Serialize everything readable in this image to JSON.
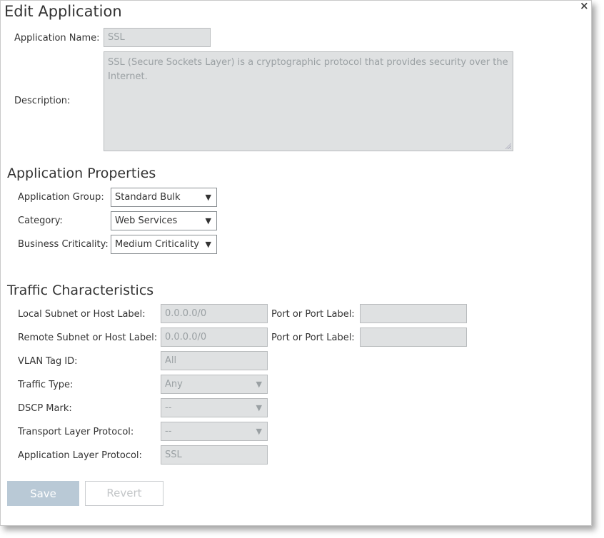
{
  "dialog": {
    "title": "Edit Application",
    "close_glyph": "×"
  },
  "general": {
    "app_name_label": "Application Name:",
    "app_name_value": "SSL",
    "description_label": "Description:",
    "description_value": "SSL (Secure Sockets Layer) is a cryptographic protocol that provides security over the Internet."
  },
  "properties": {
    "heading": "Application Properties",
    "group_label": "Application Group:",
    "group_value": "Standard Bulk",
    "category_label": "Category:",
    "category_value": "Web Services",
    "criticality_label": "Business Criticality:",
    "criticality_value": "Medium Criticality"
  },
  "traffic": {
    "heading": "Traffic Characteristics",
    "local_subnet_label": "Local Subnet or Host Label:",
    "local_subnet_value": "0.0.0.0/0",
    "local_port_label": "Port or Port Label:",
    "local_port_value": "",
    "remote_subnet_label": "Remote Subnet or Host Label:",
    "remote_subnet_value": "0.0.0.0/0",
    "remote_port_label": "Port or Port Label:",
    "remote_port_value": "",
    "vlan_label": "VLAN Tag ID:",
    "vlan_value": "All",
    "traffic_type_label": "Traffic Type:",
    "traffic_type_value": "Any",
    "dscp_label": "DSCP Mark:",
    "dscp_value": "--",
    "transport_label": "Transport Layer Protocol:",
    "transport_value": "--",
    "app_layer_label": "Application Layer Protocol:",
    "app_layer_value": "SSL"
  },
  "buttons": {
    "save": "Save",
    "revert": "Revert"
  },
  "icons": {
    "dropdown": "chevron-down-icon",
    "close": "close-icon",
    "resize": "resize-grip-icon"
  },
  "colors": {
    "disabled_field_bg": "#dfe1e2",
    "disabled_text": "#9aa0a3",
    "save_button_bg": "#b9c9d6"
  }
}
